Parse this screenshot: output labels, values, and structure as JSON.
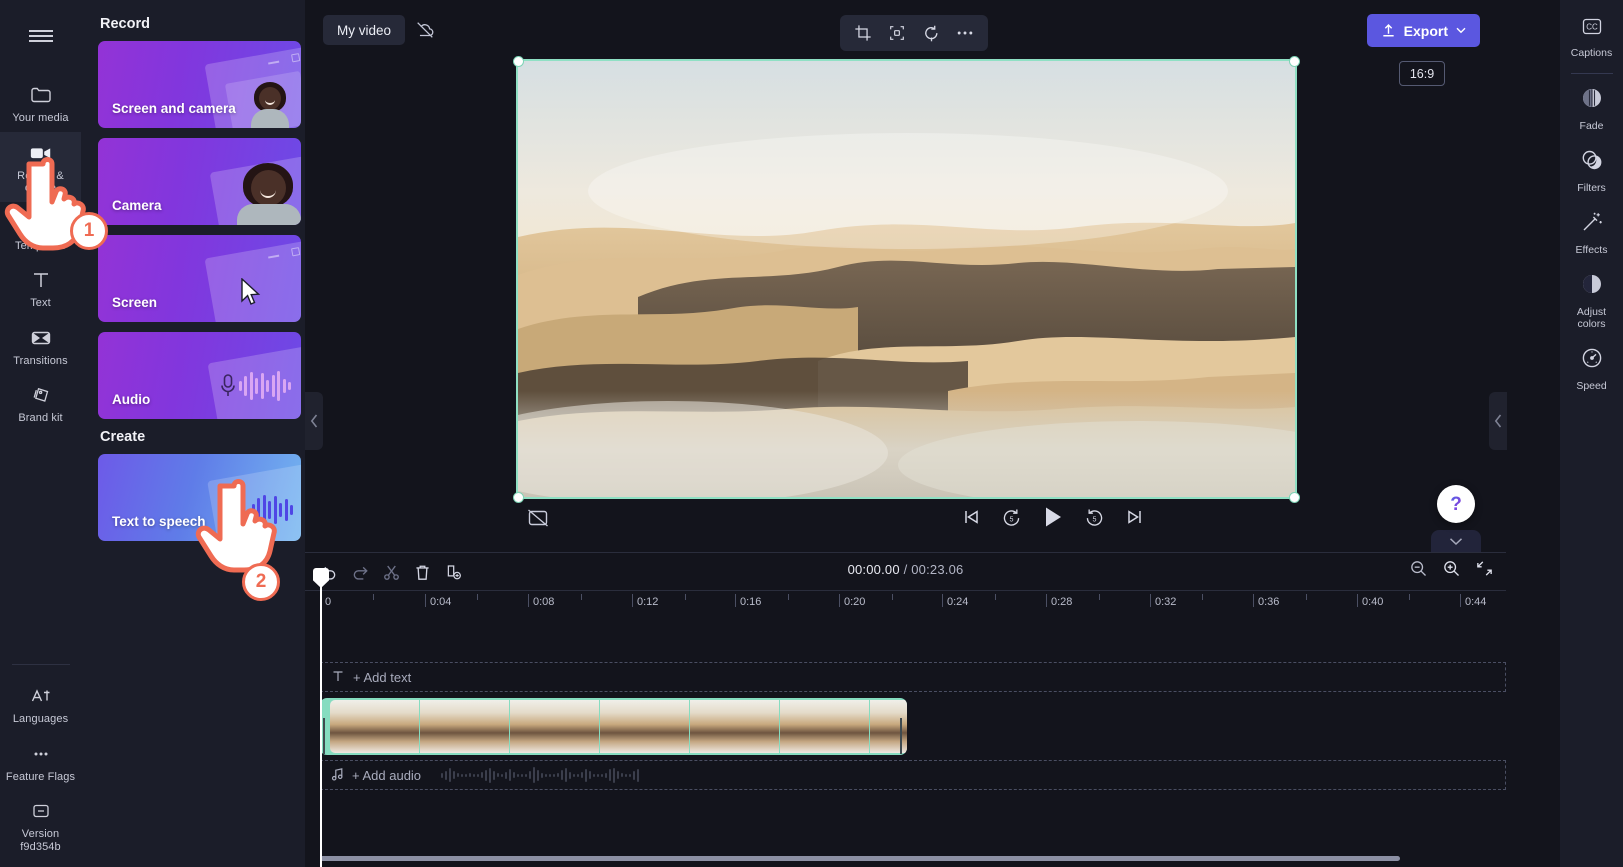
{
  "app": {
    "left_rail": {
      "menu_icon": "hamburger-icon",
      "items": [
        {
          "label": "Your media",
          "icon": "folder-icon",
          "active": false
        },
        {
          "label": "Record & create",
          "icon": "video-camera-icon",
          "active": true
        },
        {
          "label": "Templates",
          "icon": "templates-icon",
          "active": false
        },
        {
          "label": "Text",
          "icon": "text-icon",
          "active": false
        },
        {
          "label": "Transitions",
          "icon": "transitions-icon",
          "active": false
        },
        {
          "label": "Brand kit",
          "icon": "brand-kit-icon",
          "active": false
        }
      ],
      "bottom_items": [
        {
          "label": "Languages",
          "icon": "languages-icon"
        },
        {
          "label": "Feature Flags",
          "icon": "ellipsis-icon"
        },
        {
          "label": "Version f9d354b",
          "icon": "version-box-icon"
        }
      ]
    },
    "record_panel": {
      "record_heading": "Record",
      "create_heading": "Create",
      "record_cards": [
        {
          "label": "Screen and camera",
          "art": "screen-and-camera-art"
        },
        {
          "label": "Camera",
          "art": "camera-art"
        },
        {
          "label": "Screen",
          "art": "screen-art"
        },
        {
          "label": "Audio",
          "art": "audio-art"
        }
      ],
      "create_cards": [
        {
          "label": "Text to speech",
          "art": "text-to-speech-art"
        }
      ]
    },
    "stage": {
      "project_title": "My video",
      "cloud_icon": "cloud-off-icon",
      "tools": [
        {
          "name": "crop-icon"
        },
        {
          "name": "fit-to-frame-icon"
        },
        {
          "name": "rotate-icon"
        },
        {
          "name": "more-options-icon"
        }
      ],
      "export_label": "Export",
      "export_icon": "upload-icon",
      "export_chevron": "chevron-down-icon",
      "export_color": "#5b57e0",
      "aspect_ratio": "16:9",
      "selection_color": "#8fe0c4",
      "playback": {
        "captions_off_icon": "captions-off-icon",
        "skip_start_icon": "skip-to-start-icon",
        "back_5_icon": "rewind-5-icon",
        "play_icon": "play-icon",
        "forward_5_icon": "forward-5-icon",
        "skip_end_icon": "skip-to-end-icon",
        "fullscreen_icon": "fullscreen-icon"
      },
      "help_label": "?",
      "collapse_left_icon": "chevron-left-icon",
      "collapse_right_icon": "chevron-left-icon",
      "timeline_collapse_icon": "chevron-down-icon"
    },
    "right_rail": {
      "items": [
        {
          "label": "Captions",
          "icon": "closed-captions-icon"
        },
        {
          "label": "Fade",
          "icon": "fade-icon"
        },
        {
          "label": "Filters",
          "icon": "filters-icon"
        },
        {
          "label": "Effects",
          "icon": "effects-wand-icon"
        },
        {
          "label": "Adjust colors",
          "icon": "adjust-colors-icon"
        },
        {
          "label": "Speed",
          "icon": "speed-gauge-icon"
        }
      ]
    },
    "timeline": {
      "toolbar": [
        {
          "name": "undo-icon"
        },
        {
          "name": "redo-icon"
        },
        {
          "name": "split-scissors-icon"
        },
        {
          "name": "delete-trash-icon"
        },
        {
          "name": "duplicate-icon"
        }
      ],
      "current_time": "00:00.00",
      "total_time": "/ 00:23.06",
      "zoom_out_icon": "zoom-out-icon",
      "zoom_in_icon": "zoom-in-icon",
      "fit_timeline_icon": "fit-timeline-icon",
      "ruler_labels": [
        "0",
        "0:04",
        "0:08",
        "0:12",
        "0:16",
        "0:20",
        "0:24",
        "0:28",
        "0:32",
        "0:36",
        "0:40",
        "0:44"
      ],
      "text_track_label": "+ Add text",
      "text_track_icon": "text-t-icon",
      "audio_track_label": "+ Add audio",
      "audio_track_icon": "music-note-icon",
      "video_clip_name": "desert-clip"
    },
    "annotations": [
      {
        "badge": "1",
        "target": "Record & create"
      },
      {
        "badge": "2",
        "target": "Text to speech"
      }
    ]
  }
}
